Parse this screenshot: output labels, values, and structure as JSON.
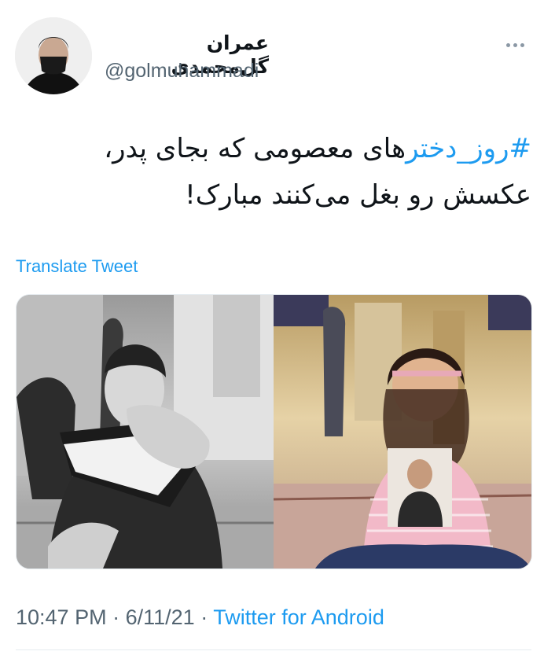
{
  "author": {
    "name": "عمران گل‌محمدی",
    "handle": "@golmuhammadi",
    "avatar_icon": "masked-man-avatar"
  },
  "more_icon": "ellipsis-icon",
  "tweet": {
    "hashtag": "#روز_دختر",
    "line1_rest": "های معصومی که بجای پدر،",
    "line2": "عکسش رو بغل می‌کنند مبارک!"
  },
  "translate_label": "Translate Tweet",
  "media": {
    "left_description_icon": "bw-photo-father-reading-holding-baby",
    "right_description_icon": "color-photo-girl-holding-father-photo"
  },
  "meta": {
    "time": "10:47 PM",
    "date": "6/11/21",
    "separator": "·",
    "source": "Twitter for Android"
  },
  "colors": {
    "link": "#1d9bf0",
    "secondary": "#536471"
  }
}
